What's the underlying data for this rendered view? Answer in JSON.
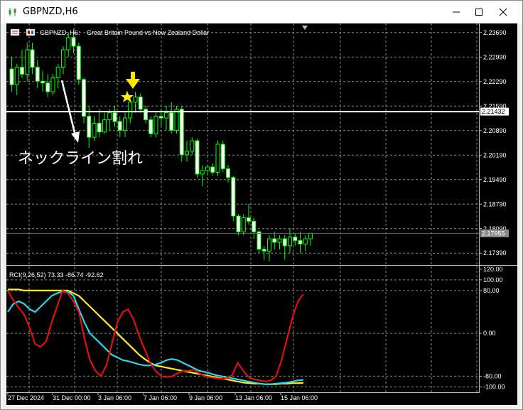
{
  "window": {
    "title": "GBPNZD,H6"
  },
  "chart_header": {
    "symbol_tf": "GBPNZD, H6:",
    "description": "Great Britain Pound vs New Zealand Dollar"
  },
  "annotation": {
    "text": "ネックライン割れ"
  },
  "chart_data": {
    "type": "candlestick",
    "symbol": "GBPNZD",
    "timeframe": "H6",
    "price_axis_ticks": [
      2.2369,
      2.2299,
      2.2229,
      2.2159,
      2.2089,
      2.2019,
      2.1949,
      2.1879,
      2.1809,
      2.1739
    ],
    "price_ylim": [
      2.1705,
      2.2395
    ],
    "neckline_price": 2.21432,
    "current_price": 2.17955,
    "time_labels": [
      "27 Dec 2024",
      "31 Dec 00:00",
      "3 Jan 06:00",
      "7 Jan 06:00",
      "9 Jan 06:00",
      "13 Jan 06:00",
      "15 Jan 06:00"
    ],
    "ohlc": [
      [
        2.2265,
        2.23,
        2.22,
        2.222
      ],
      [
        2.222,
        2.228,
        2.219,
        2.227
      ],
      [
        2.227,
        2.232,
        2.224,
        2.225
      ],
      [
        2.225,
        2.234,
        2.223,
        2.232
      ],
      [
        2.232,
        2.234,
        2.225,
        2.227
      ],
      [
        2.227,
        2.229,
        2.221,
        2.223
      ],
      [
        2.223,
        2.226,
        2.22,
        2.2225
      ],
      [
        2.2225,
        2.225,
        2.2185,
        2.22
      ],
      [
        2.22,
        2.225,
        2.219,
        2.224
      ],
      [
        2.224,
        2.228,
        2.221,
        2.227
      ],
      [
        2.227,
        2.233,
        2.225,
        2.232
      ],
      [
        2.232,
        2.237,
        2.23,
        2.2355
      ],
      [
        2.2355,
        2.238,
        2.231,
        2.233
      ],
      [
        2.233,
        2.234,
        2.222,
        2.2235
      ],
      [
        2.2235,
        2.224,
        2.211,
        2.213
      ],
      [
        2.213,
        2.216,
        2.204,
        2.207
      ],
      [
        2.207,
        2.213,
        2.206,
        2.211
      ],
      [
        2.211,
        2.215,
        2.207,
        2.2085
      ],
      [
        2.2085,
        2.214,
        2.208,
        2.212
      ],
      [
        2.212,
        2.215,
        2.209,
        2.214
      ],
      [
        2.214,
        2.216,
        2.21,
        2.2115
      ],
      [
        2.2115,
        2.213,
        2.207,
        2.209
      ],
      [
        2.209,
        2.214,
        2.207,
        2.2125
      ],
      [
        2.2125,
        2.218,
        2.211,
        2.217
      ],
      [
        2.217,
        2.22,
        2.214,
        2.2185
      ],
      [
        2.2185,
        2.2195,
        2.214,
        2.215
      ],
      [
        2.215,
        2.216,
        2.211,
        2.212
      ],
      [
        2.212,
        2.213,
        2.207,
        2.208
      ],
      [
        2.208,
        2.214,
        2.207,
        2.213
      ],
      [
        2.213,
        2.215,
        2.21,
        2.2125
      ],
      [
        2.2125,
        2.216,
        2.209,
        2.214
      ],
      [
        2.214,
        2.217,
        2.208,
        2.209
      ],
      [
        2.209,
        2.216,
        2.208,
        2.215
      ],
      [
        2.215,
        2.216,
        2.2,
        2.202
      ],
      [
        2.202,
        2.206,
        2.2,
        2.203
      ],
      [
        2.203,
        2.207,
        2.202,
        2.206
      ],
      [
        2.206,
        2.2065,
        2.1955,
        2.1965
      ],
      [
        2.1965,
        2.199,
        2.193,
        2.1975
      ],
      [
        2.1975,
        2.199,
        2.196,
        2.1985
      ],
      [
        2.1985,
        2.1995,
        2.196,
        2.197
      ],
      [
        2.197,
        2.206,
        2.196,
        2.205
      ],
      [
        2.205,
        2.206,
        2.197,
        2.198
      ],
      [
        2.198,
        2.199,
        2.194,
        2.1955
      ],
      [
        2.1955,
        2.196,
        2.183,
        2.1845
      ],
      [
        2.1845,
        2.185,
        2.179,
        2.18
      ],
      [
        2.18,
        2.185,
        2.179,
        2.184
      ],
      [
        2.184,
        2.188,
        2.182,
        2.183
      ],
      [
        2.183,
        2.184,
        2.178,
        2.18
      ],
      [
        2.18,
        2.1805,
        2.174,
        2.175
      ],
      [
        2.175,
        2.176,
        2.172,
        2.1745
      ],
      [
        2.1745,
        2.179,
        2.1715,
        2.178
      ],
      [
        2.178,
        2.18,
        2.175,
        2.177
      ],
      [
        2.177,
        2.179,
        2.175,
        2.178
      ],
      [
        2.178,
        2.179,
        2.172,
        2.176
      ],
      [
        2.176,
        2.181,
        2.174,
        2.1785
      ],
      [
        2.1785,
        2.1795,
        2.176,
        2.1775
      ],
      [
        2.1775,
        2.18,
        2.174,
        2.1765
      ],
      [
        2.1765,
        2.179,
        2.1745,
        2.178
      ],
      [
        2.178,
        2.1795,
        2.176,
        2.17955
      ]
    ],
    "indicator": {
      "name": "RCI(9,26,52)",
      "values_text": "73.33 -86.74 -92.62",
      "axis_ticks": [
        120.0,
        100.0,
        80.0,
        0.0,
        -80.0,
        -100.0
      ],
      "ylim": [
        -110,
        125
      ],
      "colors": {
        "rci9": "#e11010",
        "rci26": "#28d8e8",
        "rci52": "#ffee22"
      },
      "rci9": [
        80,
        62,
        48,
        35,
        10,
        -20,
        -25,
        -15,
        20,
        50,
        80,
        75,
        60,
        40,
        -10,
        -50,
        -70,
        -80,
        -60,
        -20,
        20,
        40,
        45,
        25,
        -5,
        -30,
        -55,
        -70,
        -80,
        -82,
        -80,
        -75,
        -70,
        -70,
        -68,
        -75,
        -80,
        -82,
        -84,
        -85,
        -84,
        -78,
        -55,
        -70,
        -82,
        -86,
        -88,
        -90,
        -88,
        -80,
        -50,
        -10,
        30,
        60,
        73.33
      ],
      "rci26": [
        40,
        55,
        60,
        55,
        45,
        40,
        50,
        60,
        70,
        75,
        78,
        78,
        70,
        45,
        20,
        0,
        -10,
        -20,
        -30,
        -40,
        -45,
        -50,
        -52,
        -55,
        -58,
        -60,
        -60,
        -58,
        -55,
        -50,
        -48,
        -50,
        -55,
        -60,
        -65,
        -70,
        -72,
        -75,
        -78,
        -80,
        -82,
        -84,
        -86,
        -88,
        -90,
        -92,
        -94,
        -95,
        -95,
        -94,
        -93,
        -92,
        -90,
        -88,
        -86.74
      ],
      "rci52": [
        82,
        82,
        82,
        80,
        80,
        80,
        80,
        80,
        80,
        80,
        80,
        80,
        75,
        70,
        60,
        50,
        40,
        30,
        20,
        10,
        0,
        -10,
        -20,
        -30,
        -40,
        -48,
        -55,
        -60,
        -62,
        -64,
        -66,
        -68,
        -70,
        -72,
        -74,
        -76,
        -78,
        -80,
        -82,
        -84,
        -86,
        -88,
        -90,
        -92,
        -93,
        -94,
        -94,
        -95,
        -95,
        -95,
        -94,
        -94,
        -93,
        -93,
        -92.62
      ]
    }
  }
}
